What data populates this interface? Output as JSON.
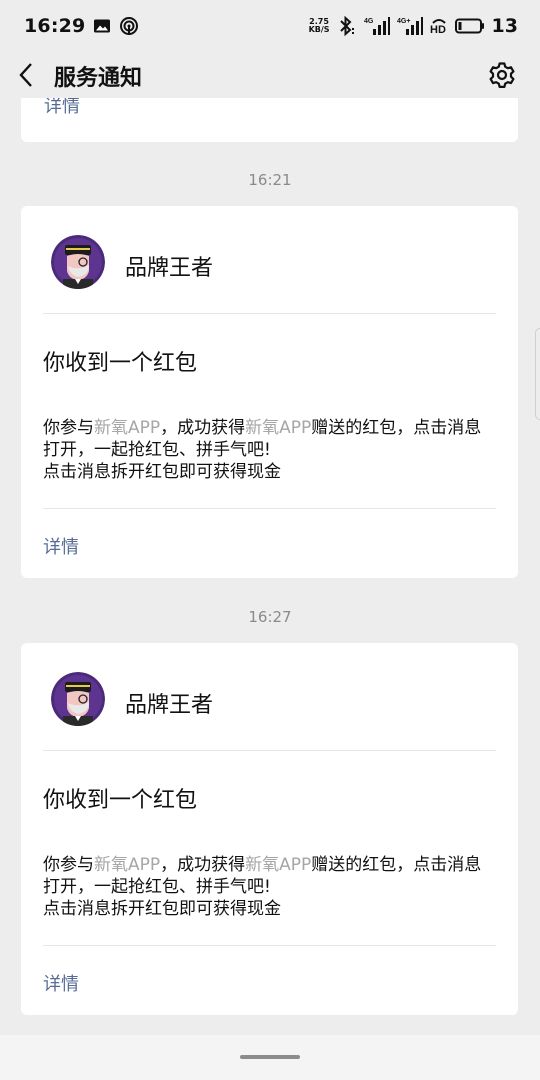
{
  "status_bar": {
    "time": "16:29",
    "net_speed_value": "2.75",
    "net_speed_unit": "KB/S",
    "signal1_label": "4G",
    "signal2_label": "4G+",
    "hd_label": "HD",
    "battery_level": "13"
  },
  "header": {
    "title": "服务通知"
  },
  "top_partial_card": {
    "detail_label": "详情"
  },
  "messages": [
    {
      "time": "16:21",
      "sender": "品牌王者",
      "title": "你收到一个红包",
      "body_part1": "你参与",
      "body_app1": "新氧APP",
      "body_part2": "，成功获得",
      "body_app2": "新氧APP",
      "body_part3": "赠送的红包，点击消息打开，一起抢红包、拼手气吧!",
      "body_line2": "点击消息拆开红包即可获得现金",
      "detail_label": "详情"
    },
    {
      "time": "16:27",
      "sender": "品牌王者",
      "title": "你收到一个红包",
      "body_part1": "你参与",
      "body_app1": "新氧APP",
      "body_part2": "，成功获得",
      "body_app2": "新氧APP",
      "body_part3": "赠送的红包，点击消息打开，一起抢红包、拼手气吧!",
      "body_line2": "点击消息拆开红包即可获得现金",
      "detail_label": "详情"
    }
  ],
  "colors": {
    "background": "#ededed",
    "card": "#ffffff",
    "link": "#576b95",
    "muted_text": "#a6a6a6",
    "avatar_bg": "#4b2a7a"
  },
  "icons": [
    "image-icon",
    "hotspot-icon",
    "bluetooth-icon",
    "signal-icon",
    "battery-icon",
    "back-chevron-icon",
    "gear-icon"
  ]
}
